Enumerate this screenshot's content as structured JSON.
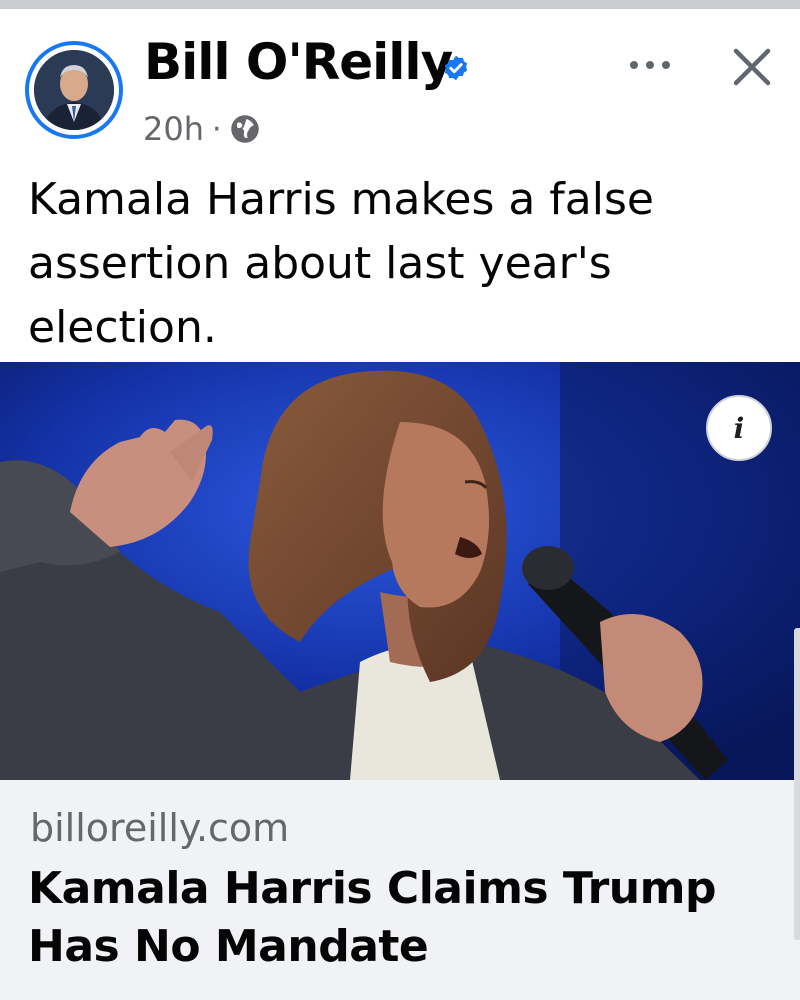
{
  "post": {
    "author": "Bill O'Reilly",
    "timestamp": "20h",
    "separator": "·",
    "text": "Kamala Harris makes a false assertion about last year's election."
  },
  "icons": {
    "verified": "verified-badge-icon",
    "audience": "globe-icon",
    "more": "more-options-icon",
    "close": "close-icon",
    "info": "info-icon"
  },
  "media": {
    "info_label": "i"
  },
  "link_preview": {
    "domain": "billoreilly.com",
    "title": "Kamala Harris Claims Trump Has No Mandate"
  },
  "colors": {
    "accent": "#1877f2",
    "secondary_text": "#65676b",
    "preview_background": "#f0f2f5"
  }
}
